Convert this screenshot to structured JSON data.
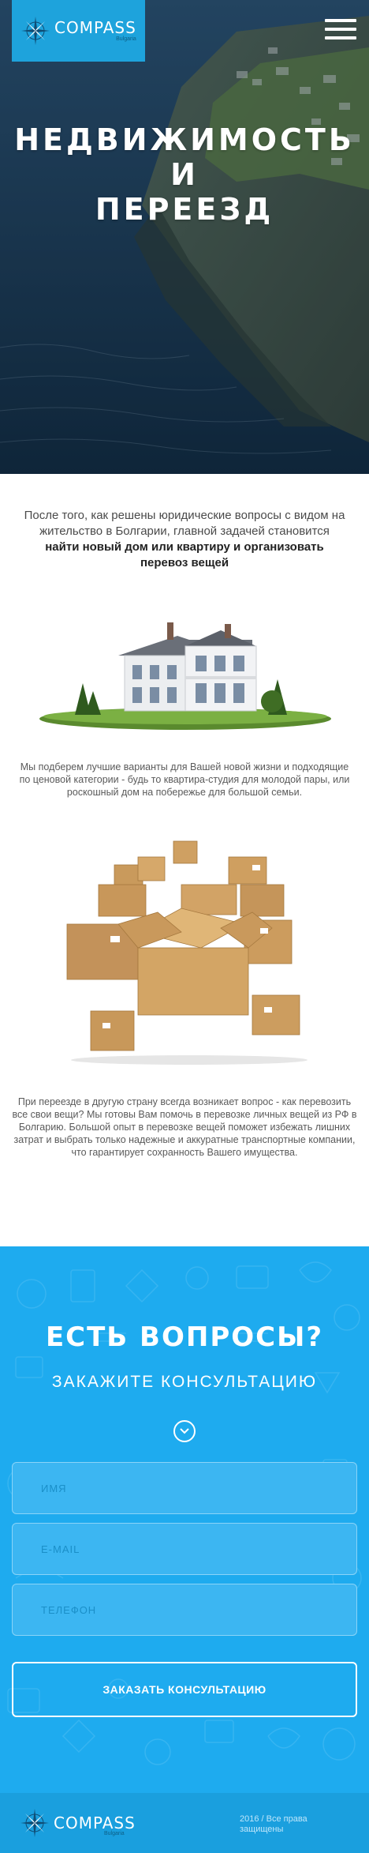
{
  "header": {
    "logo_name": "COMPASS",
    "logo_sub": "Bulgaria",
    "menu_icon": "hamburger-icon"
  },
  "hero": {
    "title": "НЕДВИЖИМОСТЬ И\nПЕРЕЕЗД"
  },
  "intro": {
    "text_before": "После того, как решены юридические вопросы с видом на жительство в Болгарии, главной задачей становится ",
    "text_bold": "найти новый дом или квартиру и организовать перевоз вещей"
  },
  "sections": {
    "housing_text": "Мы подберем лучшие варианты для Вашей новой жизни и подходящие по ценовой категории - будь то квартира-студия для молодой пары, или роскошный дом на побережье для большой семьи.",
    "moving_text": "При переезде в другую страну всегда возникает вопрос - как перевозить все свои вещи? Мы готовы Вам помочь в перевозке личных вещей из РФ в Болгарию. Большой опыт в перевозке вещей поможет избежать лишних затрат и выбрать только надежные и аккуратные транспортные компании, что гарантирует сохранность Вашего имущества."
  },
  "cta": {
    "title": "ЕСТЬ ВОПРОСЫ?",
    "subtitle": "ЗАКАЖИТЕ КОНСУЛЬТАЦИЮ",
    "name_placeholder": "ИМЯ",
    "email_placeholder": "E-MAIL",
    "phone_placeholder": "ТЕЛЕФОН",
    "submit_label": "ЗАКАЗАТЬ КОНСУЛЬТАЦИЮ"
  },
  "footer": {
    "logo_name": "COMPASS",
    "logo_sub": "Bulgaria",
    "copyright": "2016 / Все права защищены"
  },
  "colors": {
    "brand_blue": "#1ea3dc",
    "cta_background": "#1eabef",
    "footer_background": "#1a9fde"
  }
}
